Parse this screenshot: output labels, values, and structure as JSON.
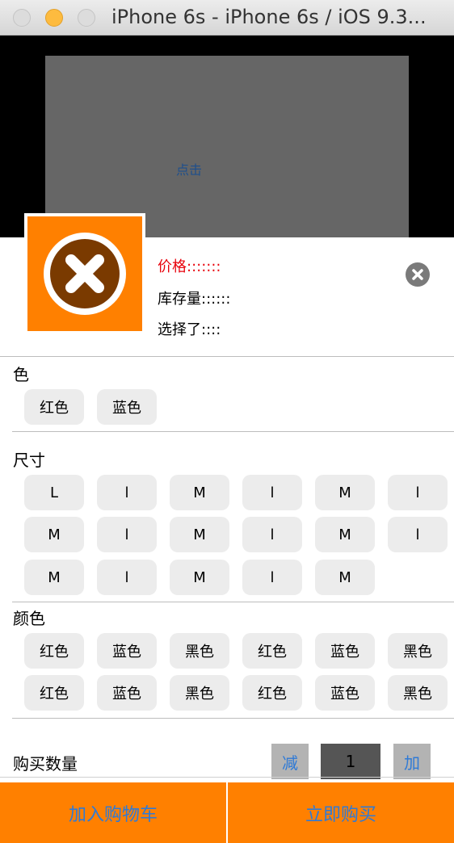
{
  "window": {
    "title": "iPhone 6s - iPhone 6s / iOS 9.3..."
  },
  "top": {
    "tap_label": "点击"
  },
  "product": {
    "price": "价格:::::::",
    "stock": "库存量::::::",
    "selected": "选择了::::"
  },
  "sections": {
    "color": {
      "title": "色",
      "options": [
        "红色",
        "蓝色"
      ]
    },
    "size": {
      "title": "尺寸",
      "options": [
        "L",
        "l",
        "M",
        "l",
        "M",
        "l",
        "M",
        "l",
        "M",
        "l",
        "M",
        "l",
        "M",
        "l",
        "M",
        "l",
        "M"
      ]
    },
    "color2": {
      "title": "颜色",
      "options": [
        "红色",
        "蓝色",
        "黑色",
        "红色",
        "蓝色",
        "黑色",
        "红色",
        "蓝色",
        "黑色",
        "红色",
        "蓝色",
        "黑色"
      ]
    }
  },
  "quantity": {
    "label": "购买数量",
    "minus": "减",
    "value": "1",
    "plus": "加"
  },
  "actions": {
    "add_to_cart": "加入购物车",
    "buy_now": "立即购买"
  },
  "colors": {
    "orange": "#ff8000",
    "price_red": "#e8000b",
    "link_blue": "#2f7ad6"
  },
  "icons": {
    "thumbnail": "x-circle-icon",
    "close": "close-icon"
  }
}
